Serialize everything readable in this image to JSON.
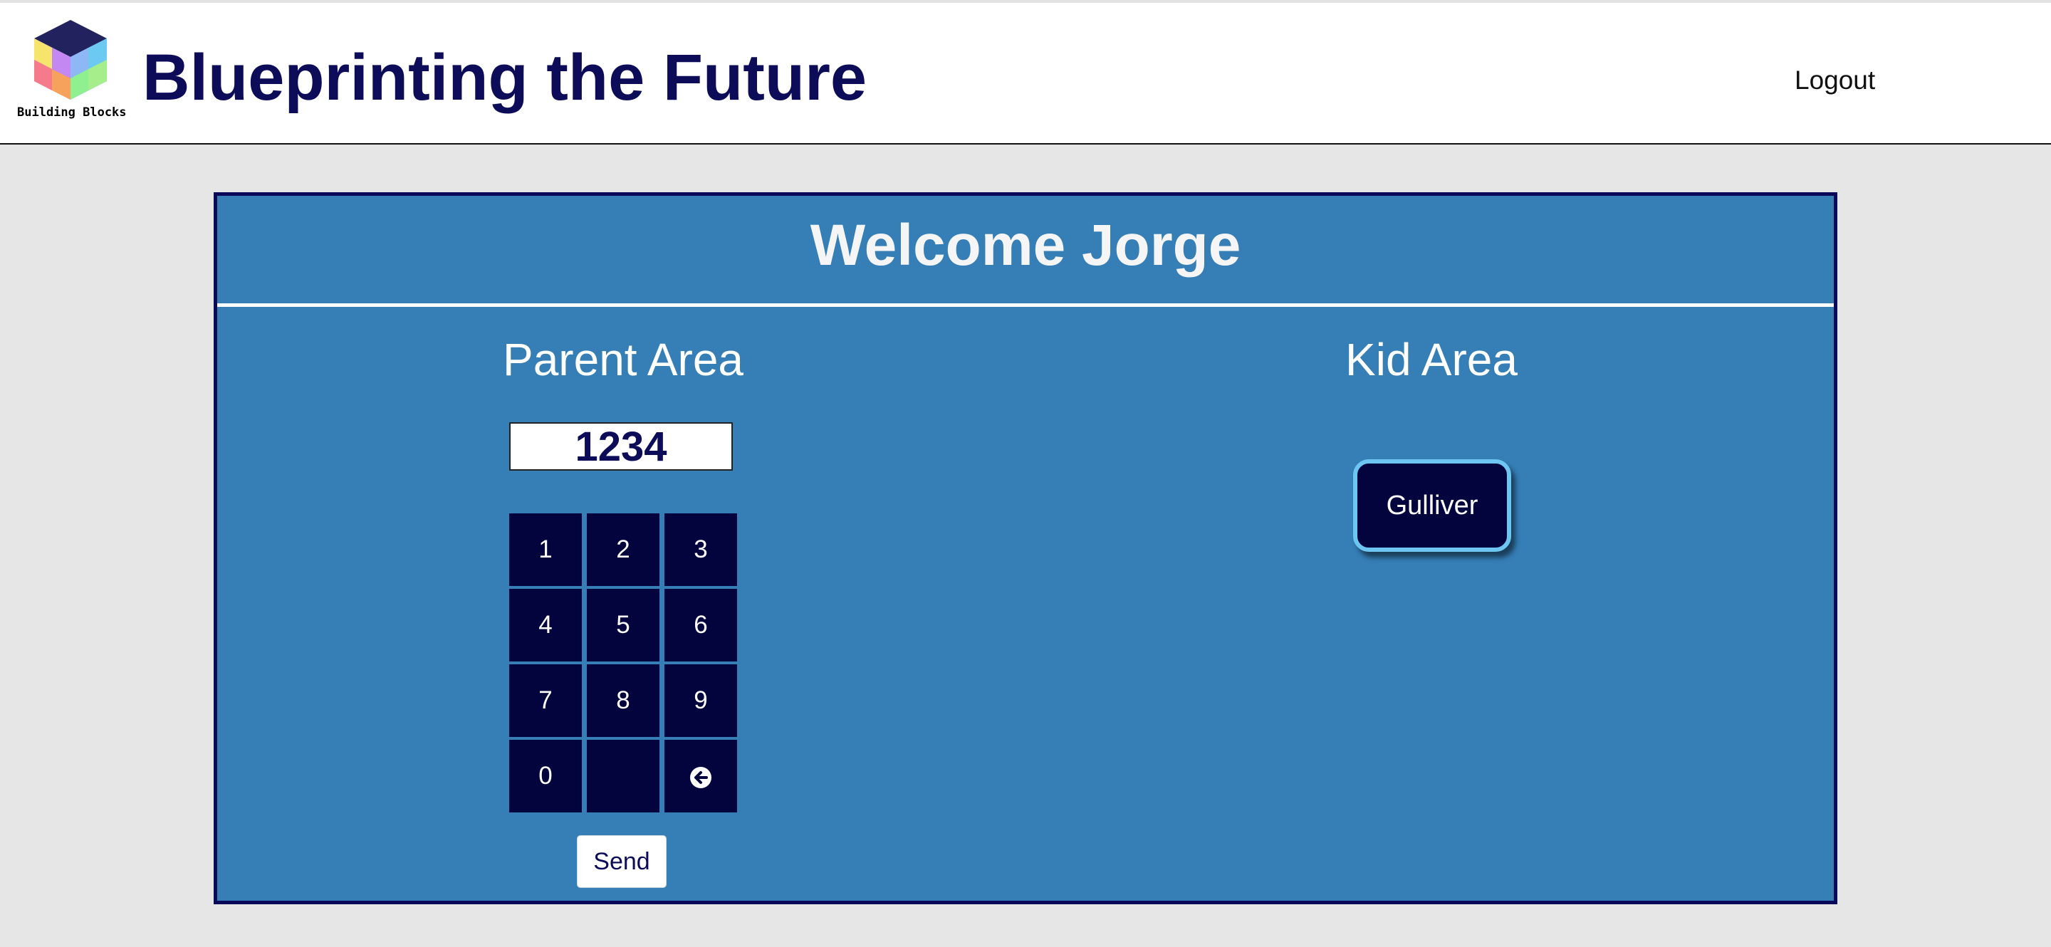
{
  "header": {
    "logo_caption": "Building Blocks",
    "title": "Blueprinting the Future",
    "logout_label": "Logout"
  },
  "main": {
    "welcome": "Welcome Jorge",
    "parent_area": {
      "title": "Parent Area",
      "pin_value": "1234",
      "keypad": {
        "keys": [
          "1",
          "2",
          "3",
          "4",
          "5",
          "6",
          "7",
          "8",
          "9",
          "0",
          "",
          "backspace-icon"
        ]
      },
      "send_label": "Send"
    },
    "kid_area": {
      "title": "Kid Area",
      "kids": [
        "Gulliver"
      ]
    }
  },
  "colors": {
    "navy": "#0d0c59",
    "panel_blue": "#357eb6",
    "key_navy": "#03033e",
    "kid_button_border": "#6cc6f1",
    "page_background": "#e6e6e6"
  }
}
